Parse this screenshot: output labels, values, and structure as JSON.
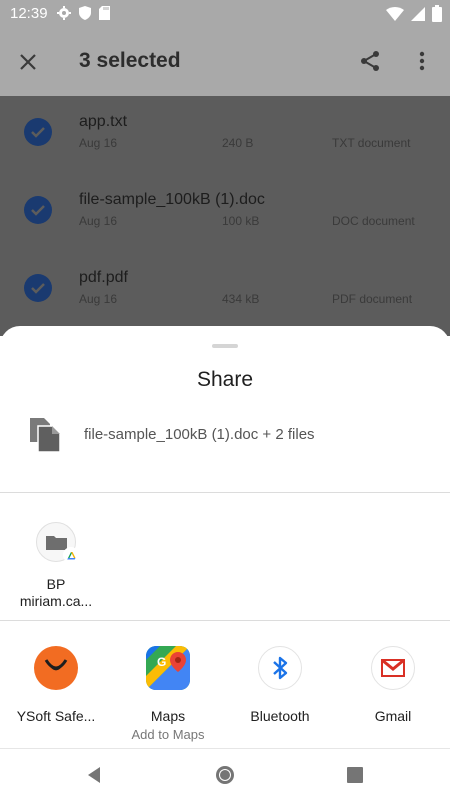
{
  "status_bar": {
    "time": "12:39"
  },
  "app_bar": {
    "title": "3 selected"
  },
  "files": [
    {
      "name": "app.txt",
      "date": "Aug 16",
      "size": "240 B",
      "type": "TXT document"
    },
    {
      "name": "file-sample_100kB (1).doc",
      "date": "Aug 16",
      "size": "100 kB",
      "type": "DOC document"
    },
    {
      "name": "pdf.pdf",
      "date": "Aug 16",
      "size": "434 kB",
      "type": "PDF document"
    }
  ],
  "share_sheet": {
    "title": "Share",
    "preview_text": "file-sample_100kB (1).doc + 2 files",
    "direct_targets": [
      {
        "label_line1": "BP",
        "label_line2": "miriam.ca..."
      }
    ],
    "apps": [
      {
        "label": "YSoft Safe...",
        "sublabel": ""
      },
      {
        "label": "Maps",
        "sublabel": "Add to Maps"
      },
      {
        "label": "Bluetooth",
        "sublabel": ""
      },
      {
        "label": "Gmail",
        "sublabel": ""
      }
    ]
  },
  "colors": {
    "scrim_statusbar": "#a9a9a9",
    "scrim_list": "#5c5c5c",
    "check_blue": "#1a3a70",
    "gmail_red": "#d93025",
    "bluetooth_blue": "#1a73e8",
    "ysoft_orange": "#f26c22"
  },
  "icons": {
    "status": [
      "gear-icon",
      "shield-icon",
      "sd-card-icon",
      "wifi-icon",
      "cellular-icon",
      "battery-icon"
    ],
    "app_bar": [
      "close-icon",
      "share-icon",
      "more-vert-icon"
    ],
    "nav": [
      "back-icon",
      "home-icon",
      "recents-icon"
    ]
  }
}
